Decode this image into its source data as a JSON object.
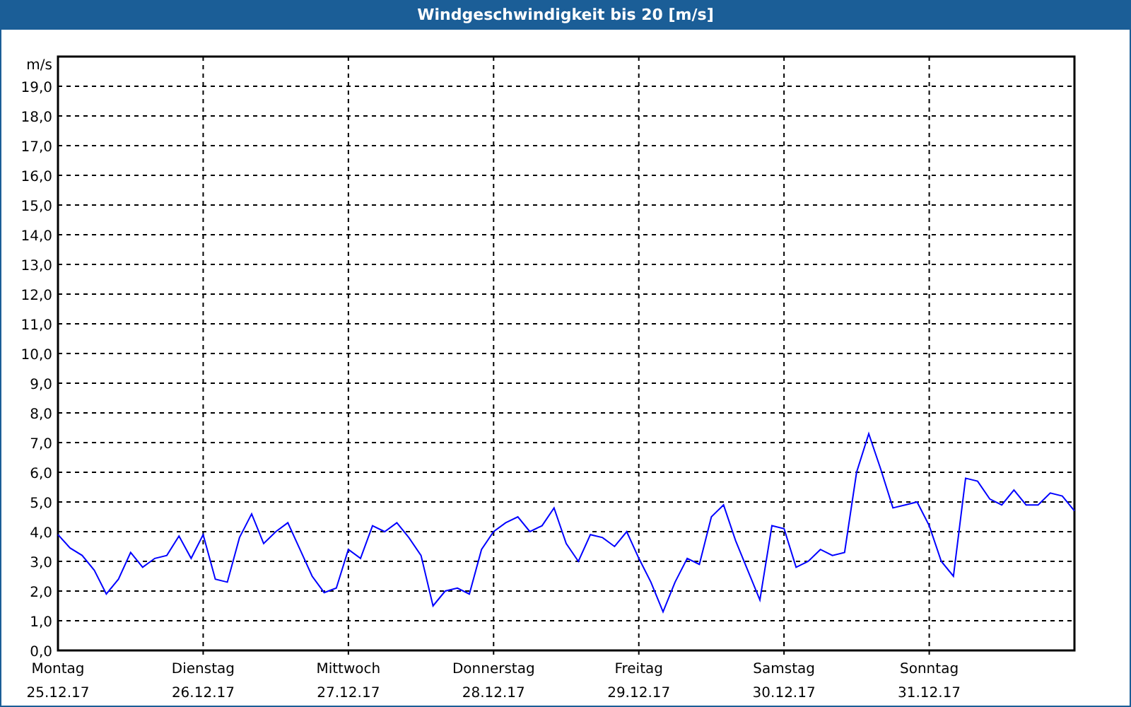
{
  "chart": {
    "chart_data": {
      "type": "line",
      "title": "Windgeschwindigkeit bis 20 [m/s]",
      "ylabel": "m/s",
      "grid": true,
      "categories": [
        "Montag",
        null,
        null,
        null,
        null,
        null,
        null,
        null,
        null,
        null,
        null,
        null,
        "Dienstag",
        null,
        null,
        null,
        null,
        null,
        null,
        null,
        null,
        null,
        null,
        null,
        "Mittwoch",
        null,
        null,
        null,
        null,
        null,
        null,
        null,
        null,
        null,
        null,
        null,
        "Donnerstag",
        null,
        null,
        null,
        null,
        null,
        null,
        null,
        null,
        null,
        null,
        null,
        "Freitag",
        null,
        null,
        null,
        null,
        null,
        null,
        null,
        null,
        null,
        null,
        null,
        "Samstag",
        null,
        null,
        null,
        null,
        null,
        null,
        null,
        null,
        null,
        null,
        null,
        "Sonntag",
        null,
        null,
        null,
        null,
        null,
        null,
        null,
        null,
        null,
        null,
        null,
        null
      ],
      "series": [
        {
          "color": "#0000ff",
          "values": [
            3.9,
            3.45,
            3.2,
            2.7,
            1.9,
            2.4,
            3.3,
            2.8,
            3.1,
            3.2,
            3.85,
            3.1,
            3.9,
            2.4,
            2.3,
            3.8,
            4.6,
            3.6,
            4.0,
            4.3,
            3.4,
            2.5,
            1.95,
            2.1,
            3.4,
            3.1,
            4.2,
            4.0,
            4.3,
            3.8,
            3.2,
            1.5,
            2.0,
            2.1,
            1.9,
            3.4,
            4.0,
            4.3,
            4.5,
            4.0,
            4.2,
            4.8,
            3.6,
            3.0,
            3.9,
            3.8,
            3.5,
            4.0,
            3.1,
            2.3,
            1.3,
            2.3,
            3.1,
            2.9,
            4.5,
            4.9,
            3.7,
            2.7,
            1.7,
            4.2,
            4.1,
            2.8,
            3.0,
            3.4,
            3.2,
            3.3,
            6.0,
            7.3,
            6.1,
            4.8,
            4.9,
            5.0,
            4.2,
            3.0,
            2.5,
            5.8,
            5.7,
            5.1,
            4.9,
            5.4,
            4.9,
            4.9,
            5.3,
            5.2,
            4.7
          ]
        }
      ],
      "ylim": [
        0,
        20
      ],
      "yticks": [
        {
          "value": 0,
          "label": "0,0"
        },
        {
          "value": 1,
          "label": "1,0"
        },
        {
          "value": 2,
          "label": "2,0"
        },
        {
          "value": 3,
          "label": "3,0"
        },
        {
          "value": 4,
          "label": "4,0"
        },
        {
          "value": 5,
          "label": "5,0"
        },
        {
          "value": 6,
          "label": "6,0"
        },
        {
          "value": 7,
          "label": "7,0"
        },
        {
          "value": 8,
          "label": "8,0"
        },
        {
          "value": 9,
          "label": "9,0"
        },
        {
          "value": 10,
          "label": "10,0"
        },
        {
          "value": 11,
          "label": "11,0"
        },
        {
          "value": 12,
          "label": "12,0"
        },
        {
          "value": 13,
          "label": "13,0"
        },
        {
          "value": 14,
          "label": "14,0"
        },
        {
          "value": 15,
          "label": "15,0"
        },
        {
          "value": 16,
          "label": "16,0"
        },
        {
          "value": 17,
          "label": "17,0"
        },
        {
          "value": 18,
          "label": "18,0"
        },
        {
          "value": 19,
          "label": "19,0"
        }
      ]
    },
    "dates": [
      "25.12.17",
      "26.12.17",
      "27.12.17",
      "28.12.17",
      "29.12.17",
      "30.12.17",
      "31.12.17"
    ]
  }
}
